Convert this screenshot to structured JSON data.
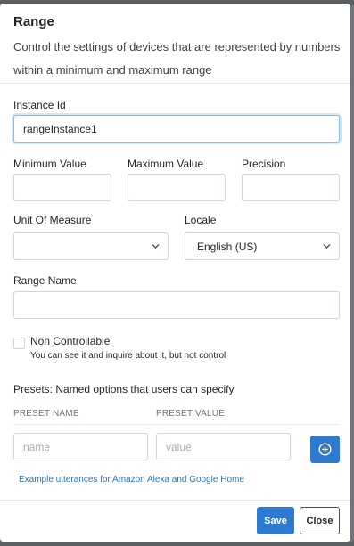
{
  "dialog": {
    "title": "Range",
    "description": "Control the settings of devices that are represented by numbers within a minimum and maximum range"
  },
  "instance_id": {
    "label": "Instance Id",
    "value": "rangeInstance1"
  },
  "minimum_value": {
    "label": "Minimum Value",
    "value": ""
  },
  "maximum_value": {
    "label": "Maximum Value",
    "value": ""
  },
  "precision": {
    "label": "Precision",
    "value": ""
  },
  "unit_of_measure": {
    "label": "Unit Of Measure",
    "selected": ""
  },
  "locale": {
    "label": "Locale",
    "selected": "English (US)"
  },
  "range_name": {
    "label": "Range Name",
    "value": ""
  },
  "non_controllable": {
    "label": "Non Controllable",
    "checked": false,
    "help": "You can see it and inquire about it, but not control"
  },
  "presets": {
    "heading": "Presets: Named options that users can specify",
    "columns": [
      "PRESET NAME",
      "PRESET VALUE"
    ],
    "name_placeholder": "name",
    "value_placeholder": "value",
    "add_icon": "plus-circle-icon"
  },
  "example_link": "Example utterances for Amazon Alexa and Google Home",
  "footer": {
    "save_label": "Save",
    "close_label": "Close"
  },
  "colors": {
    "primary": "#2f7ad1",
    "link": "#2b73c4",
    "focus_border": "#80bdff"
  }
}
